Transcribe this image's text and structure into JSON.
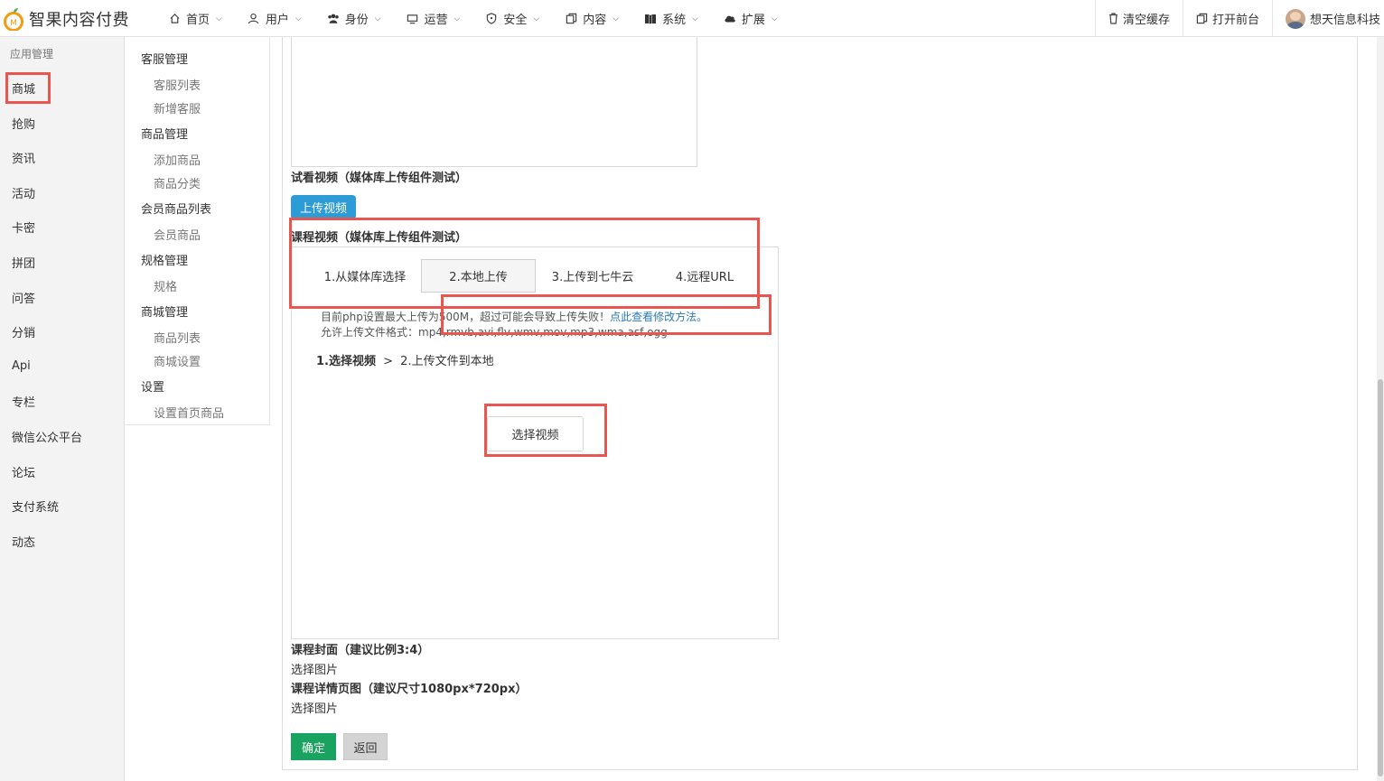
{
  "brand": {
    "name": "智果内容付费",
    "accent": "#f39c12"
  },
  "nav": [
    {
      "label": "首页",
      "icon": "home-icon"
    },
    {
      "label": "用户",
      "icon": "user-icon"
    },
    {
      "label": "身份",
      "icon": "users-icon"
    },
    {
      "label": "运营",
      "icon": "monitor-icon"
    },
    {
      "label": "安全",
      "icon": "shield-icon"
    },
    {
      "label": "内容",
      "icon": "copy-icon"
    },
    {
      "label": "系统",
      "icon": "book-icon"
    },
    {
      "label": "扩展",
      "icon": "cloud-icon"
    }
  ],
  "right_nav": {
    "clear_cache": "清空缓存",
    "open_front": "打开前台",
    "user_name": "想天信息科技"
  },
  "side1": {
    "title": "应用管理",
    "items": [
      "商城",
      "抢购",
      "资讯",
      "活动",
      "卡密",
      "拼团",
      "问答",
      "分销",
      "Api",
      "专栏",
      "微信公众平台",
      "论坛",
      "支付系统",
      "动态"
    ],
    "active": "商城"
  },
  "side2": {
    "groups": [
      {
        "label": "客服管理",
        "items": [
          "客服列表",
          "新增客服"
        ]
      },
      {
        "label": "商品管理",
        "items": [
          "添加商品",
          "商品分类"
        ]
      },
      {
        "label": "会员商品列表",
        "items": [
          "会员商品"
        ]
      },
      {
        "label": "规格管理",
        "items": [
          "规格"
        ]
      },
      {
        "label": "商城管理",
        "items": [
          "商品列表",
          "商城设置"
        ]
      },
      {
        "label": "设置",
        "items": [
          "设置首页商品"
        ]
      }
    ]
  },
  "form": {
    "trial_video_label": "试看视频（媒体库上传组件测试）",
    "upload_video_btn": "上传视频",
    "course_video_label": "课程视频（媒体库上传组件测试）",
    "tabs": [
      "1.从媒体库选择",
      "2.本地上传",
      "3.上传到七牛云",
      "4.远程URL"
    ],
    "active_tab": "2.本地上传",
    "tip_line1": "目前php设置最大上传为500M，超过可能会导致上传失败！",
    "tip_link": "点此查看修改方法。",
    "tip_line2": "允许上传文件格式：mp4,rmvb,avi,flv,wmv,mov,mp3,wma,asf,ogg",
    "step1": "1.选择视频",
    "step_sep": ">",
    "step2": "2.上传文件到本地",
    "choose_video_btn": "选择视频",
    "cover_label": "课程封面（建议比例3:4）",
    "cover_select": "选择图片",
    "detail_label": "课程详情页图（建议尺寸1080px*720px）",
    "detail_select": "选择图片",
    "ok_btn": "确定",
    "back_btn": "返回"
  },
  "colors": {
    "highlight": "#e9564f",
    "primary": "#2d9bd6",
    "success": "#1aa260",
    "link": "#2a7ab7"
  }
}
